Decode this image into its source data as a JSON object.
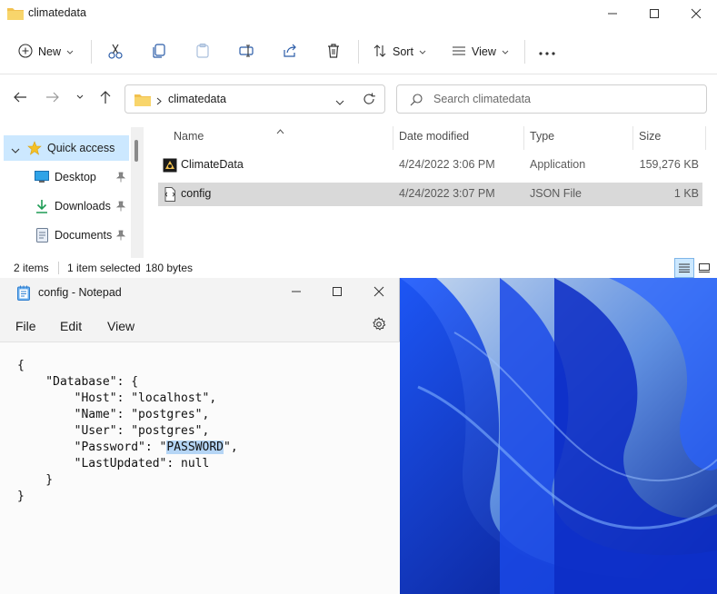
{
  "explorer": {
    "window_title": "climatedata",
    "toolbar": {
      "new_label": "New",
      "sort_label": "Sort",
      "view_label": "View"
    },
    "address": {
      "path": "climatedata",
      "search_placeholder": "Search climatedata"
    },
    "nav": {
      "items": [
        {
          "label": "Quick access",
          "icon": "star-icon"
        },
        {
          "label": "Desktop",
          "icon": "desktop-icon"
        },
        {
          "label": "Downloads",
          "icon": "download-icon"
        },
        {
          "label": "Documents",
          "icon": "document-icon"
        }
      ]
    },
    "columns": [
      "Name",
      "Date modified",
      "Type",
      "Size"
    ],
    "files": [
      {
        "name": "ClimateData",
        "date": "4/24/2022 3:06 PM",
        "type": "Application",
        "size": "159,276 KB"
      },
      {
        "name": "config",
        "date": "4/24/2022 3:07 PM",
        "type": "JSON File",
        "size": "1 KB"
      }
    ],
    "status": {
      "count": "2 items",
      "selection": "1 item selected",
      "size": "180 bytes"
    }
  },
  "notepad": {
    "title": "config - Notepad",
    "menu": [
      "File",
      "Edit",
      "View"
    ],
    "content": {
      "line1": "{",
      "line2": "    \"Database\": {",
      "line3": "        \"Host\": \"localhost\",",
      "line4": "        \"Name\": \"postgres\",",
      "line5": "        \"User\": \"postgres\",",
      "line6_pre": "        \"Password\": \"",
      "line6_sel": "PASSWORD",
      "line6_post": "\",",
      "line7": "        \"LastUpdated\": null",
      "line8": "    }",
      "line9": "}"
    }
  },
  "colors": {
    "selection": "#cce8ff",
    "row_selected": "#d9d9d9",
    "text_highlight": "#b5d5f5",
    "wallpaper": "#1a3fd1"
  }
}
